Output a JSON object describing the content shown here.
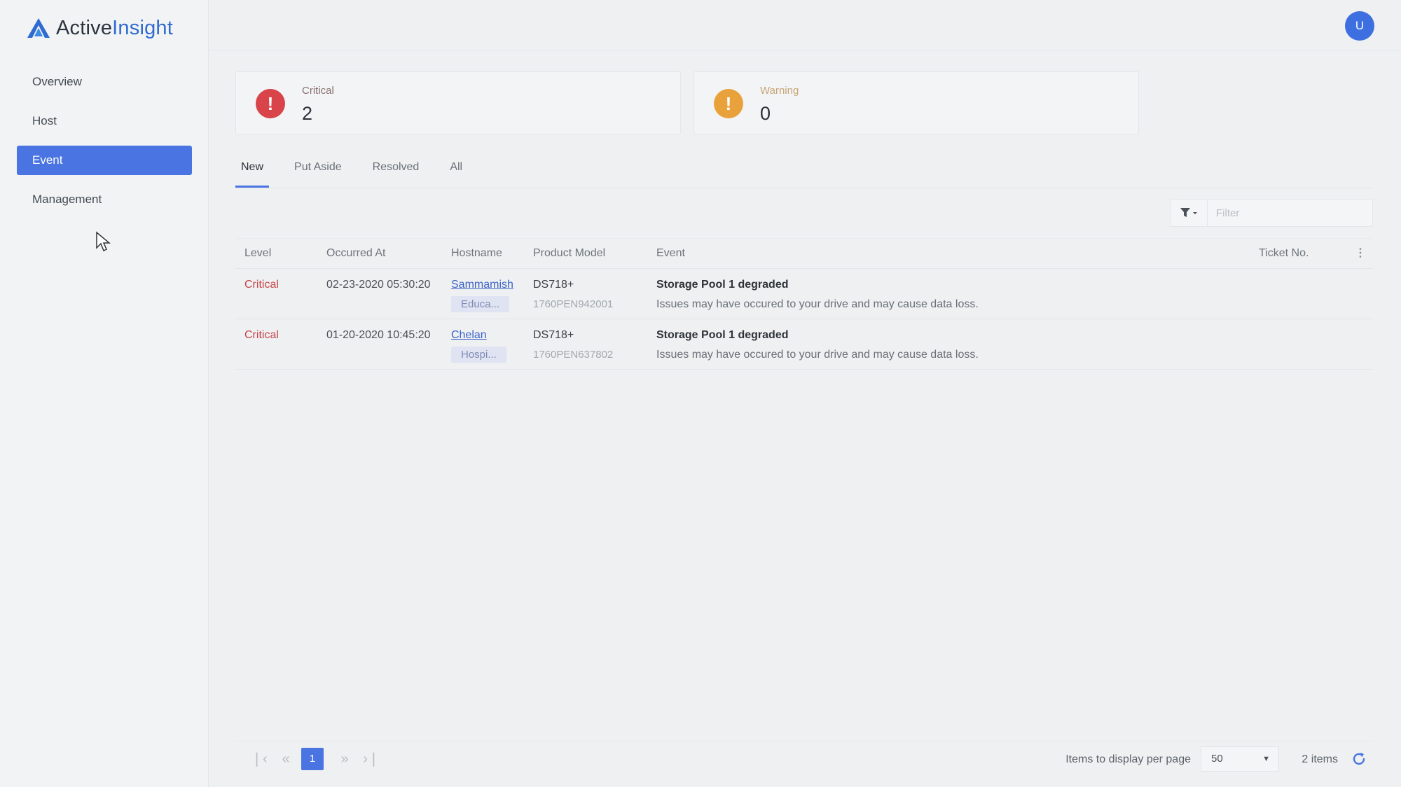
{
  "app": {
    "logo_part1": "Active",
    "logo_part2": "Insight",
    "user_initial": "U"
  },
  "sidebar": {
    "items": [
      {
        "label": "Overview",
        "active": false
      },
      {
        "label": "Host",
        "active": false
      },
      {
        "label": "Event",
        "active": true
      },
      {
        "label": "Management",
        "active": false
      }
    ]
  },
  "summary": {
    "critical": {
      "label": "Critical",
      "count": "2",
      "icon": "exclamation-icon",
      "color": "#d9434a"
    },
    "warning": {
      "label": "Warning",
      "count": "0",
      "icon": "exclamation-icon",
      "color": "#e9a23b"
    }
  },
  "tabs": [
    {
      "label": "New",
      "active": true
    },
    {
      "label": "Put Aside",
      "active": false
    },
    {
      "label": "Resolved",
      "active": false
    },
    {
      "label": "All",
      "active": false
    }
  ],
  "filter": {
    "placeholder": "Filter"
  },
  "table": {
    "columns": [
      "Level",
      "Occurred At",
      "Hostname",
      "Product Model",
      "Event",
      "Ticket No."
    ],
    "rows": [
      {
        "level": "Critical",
        "occurred_at": "02-23-2020 05:30:20",
        "hostname": "Sammamish",
        "tag": "Educa...",
        "model": "DS718+",
        "serial": "1760PEN942001",
        "event_title": "Storage Pool 1 degraded",
        "event_desc": "Issues may have occured to your drive and may cause data loss.",
        "ticket": ""
      },
      {
        "level": "Critical",
        "occurred_at": "01-20-2020 10:45:20",
        "hostname": "Chelan",
        "tag": "Hospi...",
        "model": "DS718+",
        "serial": "1760PEN637802",
        "event_title": "Storage Pool 1 degraded",
        "event_desc": "Issues may have occured to your drive and may cause data loss.",
        "ticket": ""
      }
    ]
  },
  "pagination": {
    "current_page": "1",
    "per_page_label": "Items to display per page",
    "per_page_value": "50",
    "total": "2 items"
  },
  "colors": {
    "accent": "#4a74e2",
    "critical": "#d9434a",
    "warning": "#e9a23b"
  }
}
